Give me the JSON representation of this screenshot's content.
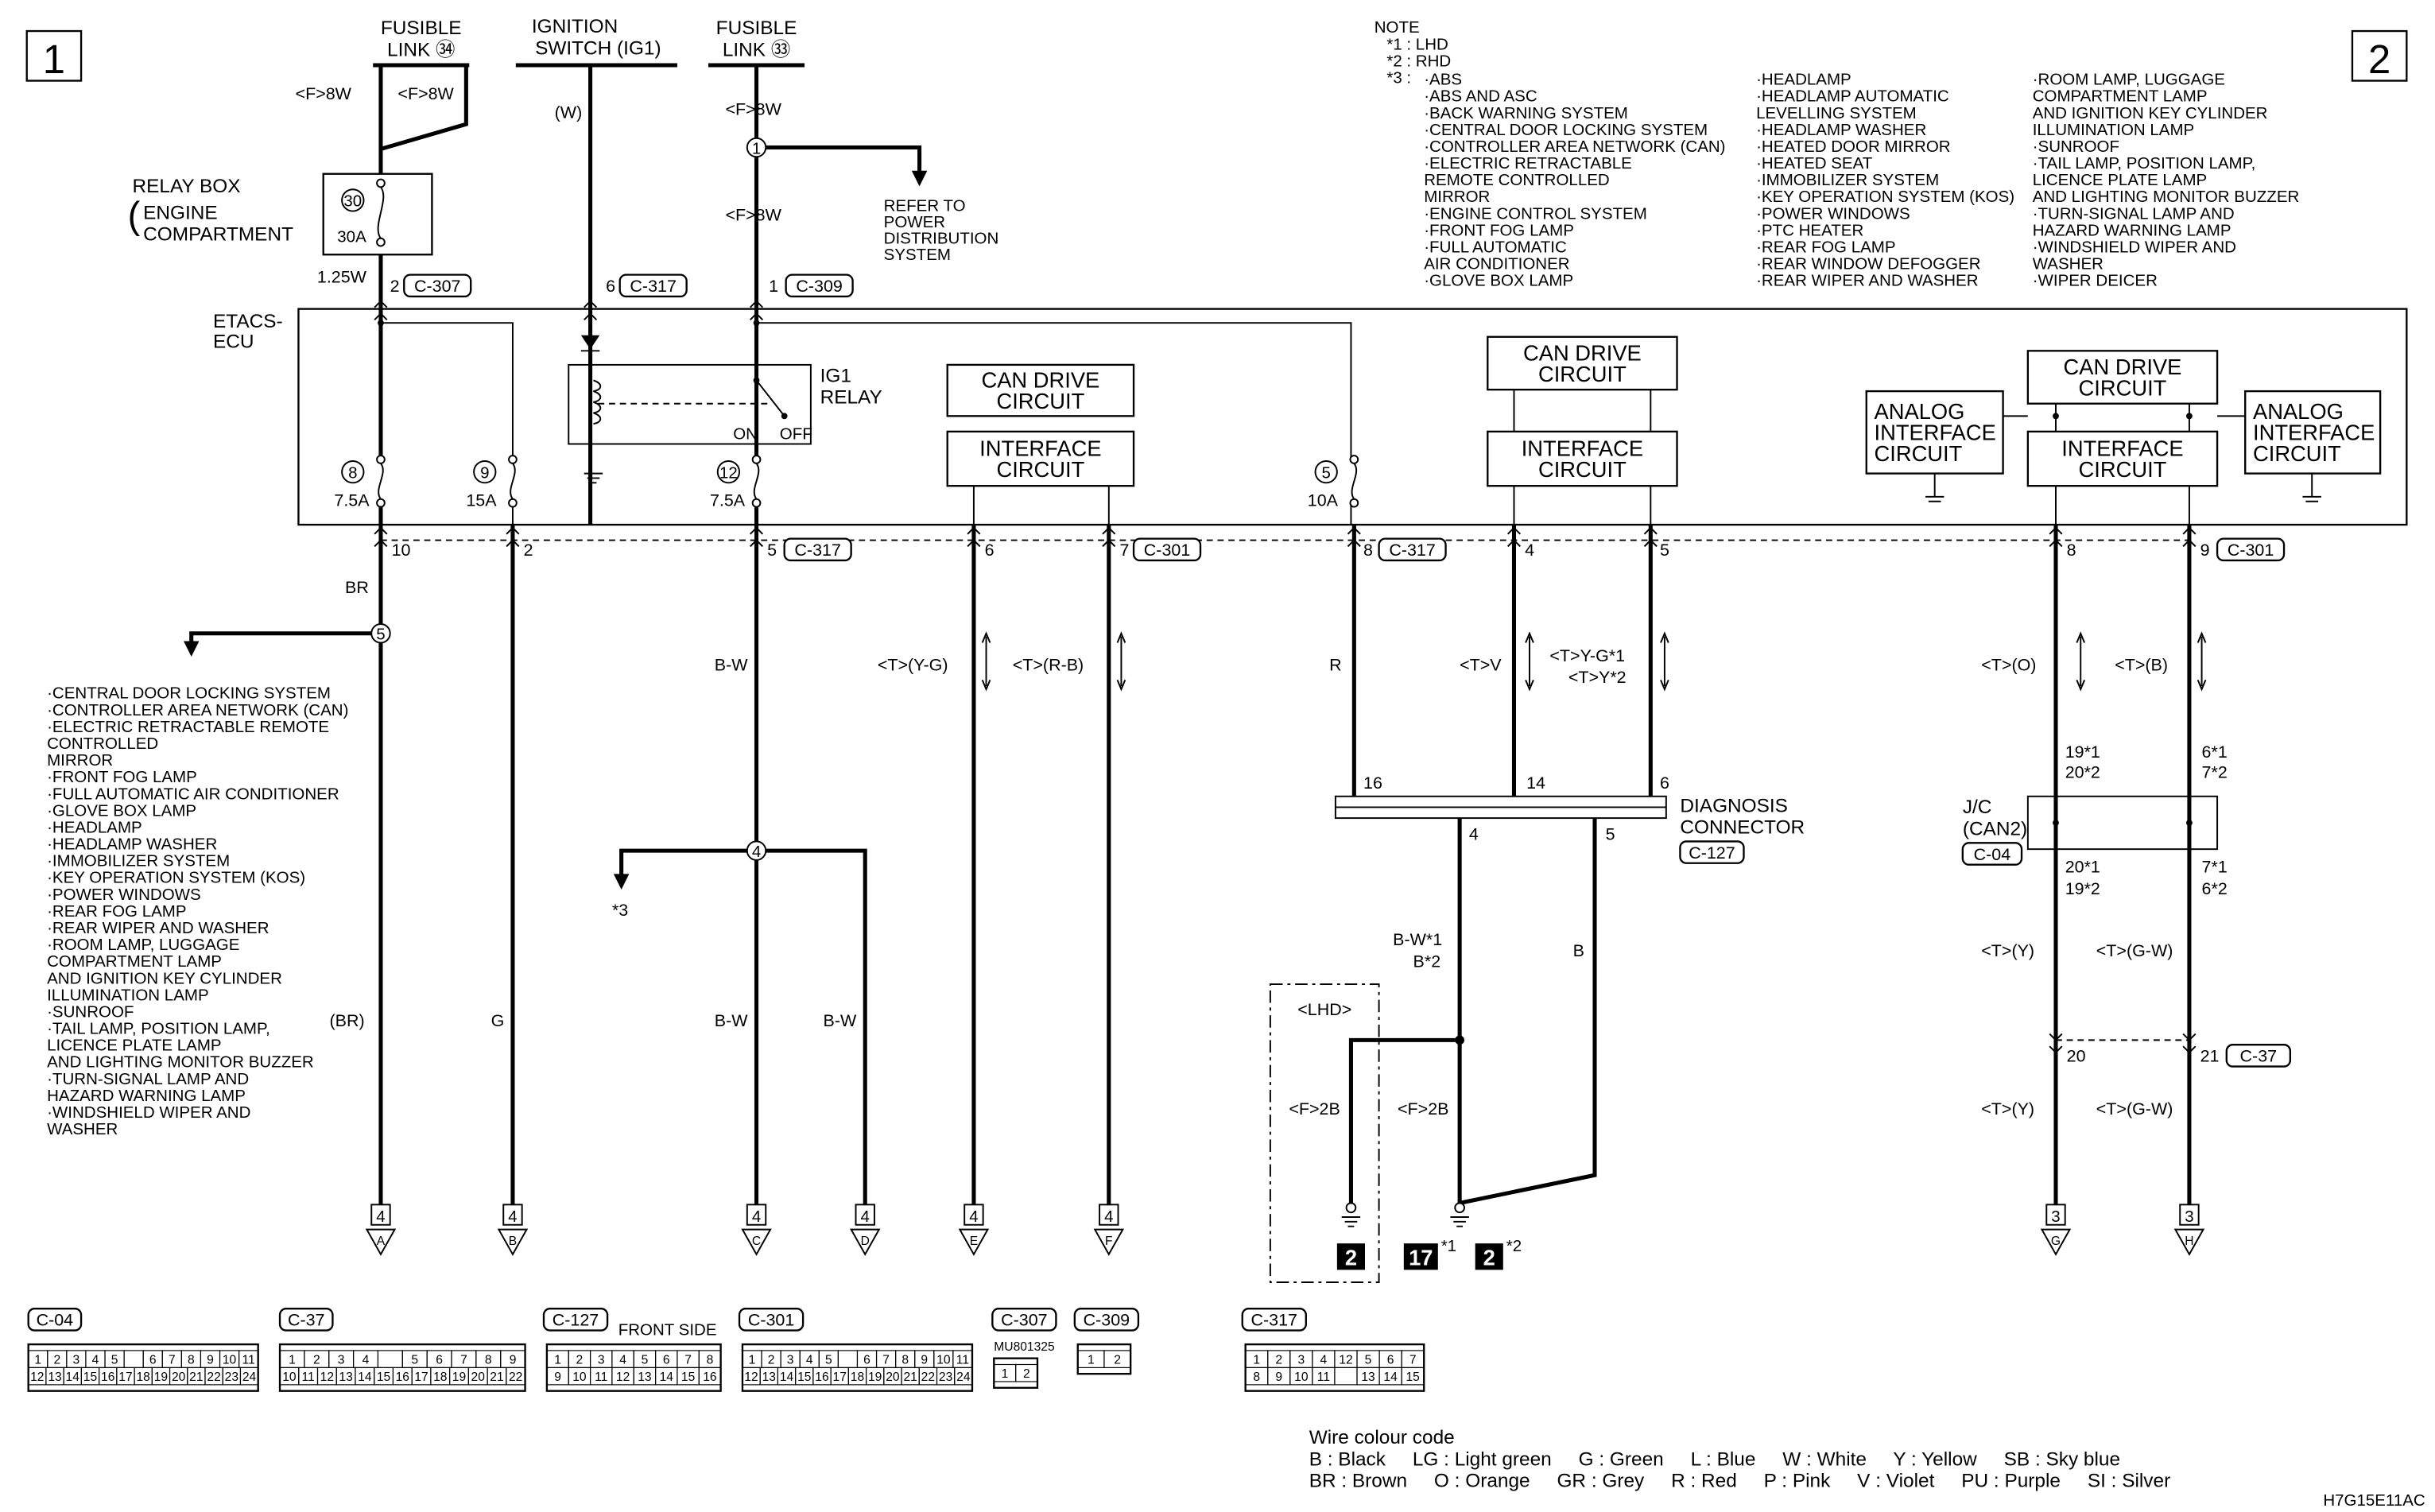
{
  "page_markers": {
    "left": "1",
    "right": "2"
  },
  "sources": {
    "fusible_link_34": {
      "line1": "FUSIBLE",
      "line2": "LINK ㉞"
    },
    "ignition_switch": {
      "line1": "IGNITION",
      "line2": "SWITCH (IG1)"
    },
    "fusible_link_33": {
      "line1": "FUSIBLE",
      "line2": "LINK ㉝"
    }
  },
  "relay_box": {
    "line1": "RELAY BOX",
    "line2": "ENGINE",
    "line3": "COMPARTMENT",
    "fuse_no": "30",
    "fuse_rating": "30A"
  },
  "refer": {
    "lines": [
      "REFER TO",
      "POWER",
      "DISTRIBUTION",
      "SYSTEM"
    ]
  },
  "ecu": {
    "line1": "ETACS-",
    "line2": "ECU"
  },
  "ig1_relay": {
    "line1": "IG1",
    "line2": "RELAY",
    "on": "ON",
    "off": "OFF"
  },
  "circuits": {
    "can_drive": [
      "CAN DRIVE",
      "CIRCUIT"
    ],
    "interface": [
      "INTERFACE",
      "CIRCUIT"
    ],
    "analog": [
      "ANALOG",
      "INTERFACE",
      "CIRCUIT"
    ]
  },
  "fuses": [
    {
      "no": "8",
      "rating": "7.5A"
    },
    {
      "no": "9",
      "rating": "15A"
    },
    {
      "no": "12",
      "rating": "7.5A"
    },
    {
      "no": "5",
      "rating": "10A"
    }
  ],
  "nodes": {
    "n1": "1",
    "n5": "5",
    "n4": "4"
  },
  "labels": {
    "f8w_1": "<F>8W",
    "f8w_2": "<F>8W",
    "w": "(W)",
    "f8w_3": "<F>8W",
    "f8w_4": "<F>8W",
    "w125": "1.25W",
    "pin2_c307": "2",
    "c307": "C-307",
    "pin6_c317": "6",
    "c317a": "C-317",
    "pin1_c309": "1",
    "c309": "C-309",
    "p10": "10",
    "p2": "2",
    "p5": "5",
    "c317b": "C-317",
    "p6": "6",
    "p7": "7",
    "c301a": "C-301",
    "p8": "8",
    "c317c": "C-317",
    "p4": "4",
    "p5b": "5",
    "p8b": "8",
    "p9": "9",
    "c301b": "C-301",
    "br": "BR",
    "br_paren": "(BR)",
    "g": "G",
    "bw1": "B-W",
    "bw2": "B-W",
    "bw3": "B-W",
    "star3": "*3",
    "t_yg": "<T>(Y-G)",
    "t_rb": "<T>(R-B)",
    "r": "R",
    "t_v": "<T>V",
    "t_yg1": "<T>Y-G*1",
    "t_y2": "<T>Y*2",
    "t_o": "<T>(O)",
    "t_b": "<T>(B)",
    "dc16": "16",
    "dc14": "14",
    "dc6": "6",
    "dc4": "4",
    "dc5": "5",
    "diag1": "DIAGNOSIS",
    "diag2": "CONNECTOR",
    "c127": "C-127",
    "bw_star1": "B-W*1",
    "b_star2": "B*2",
    "b": "B",
    "lhd": "<LHD>",
    "f2b_1": "<F>2B",
    "f2b_2": "<F>2B",
    "gnd2": "2",
    "gnd17": "17",
    "star1": "*1",
    "gnd2b": "2",
    "star2": "*2",
    "jc19_1": "19*1",
    "jc20_2": "20*2",
    "jc6_1": "6*1",
    "jc7_2": "7*2",
    "jc1": "J/C",
    "jc2": "(CAN2)",
    "c04": "C-04",
    "jc20_1": "20*1",
    "jc19_2": "19*2",
    "jc7_1": "7*1",
    "jc6_2": "6*2",
    "t_y_a": "<T>(Y)",
    "t_gw_a": "<T>(G-W)",
    "p20": "20",
    "p21": "21",
    "c37": "C-37",
    "t_y_b": "<T>(Y)",
    "t_gw_b": "<T>(G-W)",
    "front_side": "FRONT SIDE",
    "mu": "MU801325",
    "code": "H7G15E11AC"
  },
  "ends": [
    {
      "page": "4",
      "letter": "A"
    },
    {
      "page": "4",
      "letter": "B"
    },
    {
      "page": "4",
      "letter": "C"
    },
    {
      "page": "4",
      "letter": "D"
    },
    {
      "page": "4",
      "letter": "E"
    },
    {
      "page": "4",
      "letter": "F"
    },
    {
      "page": "3",
      "letter": "G"
    },
    {
      "page": "3",
      "letter": "H"
    }
  ],
  "left_list": [
    "·CENTRAL DOOR LOCKING SYSTEM",
    "·CONTROLLER AREA NETWORK (CAN)",
    "·ELECTRIC RETRACTABLE REMOTE",
    " CONTROLLED",
    " MIRROR",
    "·FRONT FOG LAMP",
    "·FULL AUTOMATIC AIR CONDITIONER",
    "·GLOVE BOX LAMP",
    "·HEADLAMP",
    "·HEADLAMP WASHER",
    "·IMMOBILIZER SYSTEM",
    "·KEY OPERATION SYSTEM (KOS)",
    "·POWER WINDOWS",
    "·REAR FOG LAMP",
    "·REAR WIPER AND WASHER",
    "·ROOM LAMP, LUGGAGE",
    " COMPARTMENT LAMP",
    " AND IGNITION KEY CYLINDER",
    " ILLUMINATION LAMP",
    "·SUNROOF",
    "·TAIL LAMP, POSITION LAMP,",
    " LICENCE PLATE LAMP",
    " AND LIGHTING MONITOR BUZZER",
    "·TURN-SIGNAL LAMP AND",
    " HAZARD WARNING LAMP",
    "·WINDSHIELD WIPER AND",
    " WASHER"
  ],
  "note": {
    "title": "NOTE",
    "keys": [
      "*1 : LHD",
      "*2 : RHD",
      "*3 :"
    ],
    "col1": [
      "·ABS",
      "·ABS AND ASC",
      "·BACK WARNING SYSTEM",
      "·CENTRAL DOOR LOCKING SYSTEM",
      "·CONTROLLER AREA NETWORK (CAN)",
      "·ELECTRIC RETRACTABLE",
      " REMOTE CONTROLLED",
      " MIRROR",
      "·ENGINE CONTROL SYSTEM",
      "·FRONT FOG LAMP",
      "·FULL AUTOMATIC",
      " AIR CONDITIONER",
      "·GLOVE BOX LAMP"
    ],
    "col2": [
      "·HEADLAMP",
      "·HEADLAMP AUTOMATIC",
      " LEVELLING SYSTEM",
      "·HEADLAMP WASHER",
      "·HEATED DOOR MIRROR",
      "·HEATED SEAT",
      "·IMMOBILIZER SYSTEM",
      "·KEY OPERATION SYSTEM (KOS)",
      "·POWER WINDOWS",
      "·PTC HEATER",
      "·REAR FOG LAMP",
      "·REAR WINDOW DEFOGGER",
      "·REAR WIPER AND WASHER"
    ],
    "col3": [
      "·ROOM LAMP, LUGGAGE",
      " COMPARTMENT LAMP",
      " AND IGNITION KEY CYLINDER",
      " ILLUMINATION LAMP",
      "·SUNROOF",
      "·TAIL LAMP, POSITION LAMP,",
      " LICENCE PLATE LAMP",
      " AND LIGHTING MONITOR BUZZER",
      "·TURN-SIGNAL LAMP AND",
      " HAZARD WARNING LAMP",
      "·WINDSHIELD WIPER AND",
      " WASHER",
      "·WIPER DEICER"
    ]
  },
  "connectors": [
    {
      "label": "C-04",
      "rows": [
        [
          "1",
          "2",
          "3",
          "4",
          "5",
          "",
          "6",
          "7",
          "8",
          "9",
          "10",
          "11"
        ],
        [
          "12",
          "13",
          "14",
          "15",
          "16",
          "17",
          "18",
          "19",
          "20",
          "21",
          "22",
          "23",
          "24"
        ]
      ]
    },
    {
      "label": "C-37",
      "rows": [
        [
          "1",
          "2",
          "3",
          "4",
          "",
          "5",
          "6",
          "7",
          "8",
          "9"
        ],
        [
          "10",
          "11",
          "12",
          "13",
          "14",
          "15",
          "16",
          "17",
          "18",
          "19",
          "20",
          "21",
          "22"
        ]
      ]
    },
    {
      "label": "C-127",
      "rows": [
        [
          "1",
          "2",
          "3",
          "4",
          "5",
          "6",
          "7",
          "8"
        ],
        [
          "9",
          "10",
          "11",
          "12",
          "13",
          "14",
          "15",
          "16"
        ]
      ]
    },
    {
      "label": "C-301",
      "rows": [
        [
          "1",
          "2",
          "3",
          "4",
          "5",
          "",
          "6",
          "7",
          "8",
          "9",
          "10",
          "11"
        ],
        [
          "12",
          "13",
          "14",
          "15",
          "16",
          "17",
          "18",
          "19",
          "20",
          "21",
          "22",
          "23",
          "24"
        ]
      ]
    },
    {
      "label": "C-307",
      "rows": [
        [
          "1",
          "2"
        ]
      ]
    },
    {
      "label": "C-309",
      "rows": [
        [
          "1",
          "2"
        ]
      ]
    },
    {
      "label": "C-317",
      "rows": [
        [
          "1",
          "2",
          "3",
          "4",
          "12",
          "5",
          "6",
          "7"
        ],
        [
          "8",
          "9",
          "10",
          "11",
          "",
          "13",
          "14",
          "15"
        ]
      ]
    }
  ],
  "wire_colour_code": {
    "title": "Wire colour code",
    "row1": "B : Black     LG : Light green     G : Green     L : Blue     W : White     Y : Yellow     SB : Sky blue",
    "row2": "BR : Brown     O : Orange     GR : Grey     R : Red     P : Pink     V : Violet     PU : Purple     SI : Silver"
  }
}
